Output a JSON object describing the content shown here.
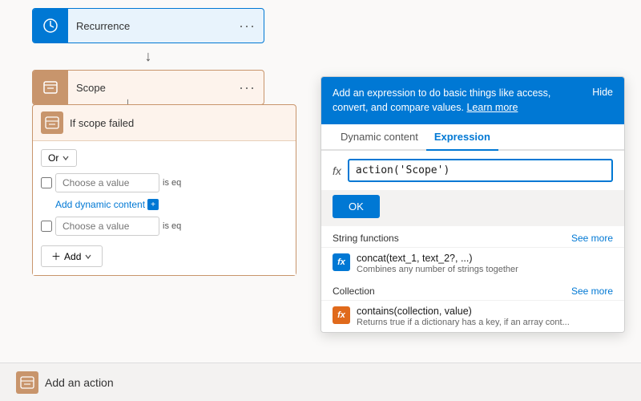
{
  "flow": {
    "recurrence": {
      "label": "Recurrence",
      "more_icon": "..."
    },
    "scope": {
      "label": "Scope",
      "more_icon": "..."
    },
    "condition": {
      "label": "If scope failed",
      "or_label": "Or",
      "row1_placeholder": "Choose a value",
      "row1_badge": "is eq",
      "dynamic_content_label": "Add dynamic content",
      "row2_placeholder": "Choose a value",
      "row2_badge": "is eq",
      "add_label": "Add"
    }
  },
  "bottom_bar": {
    "add_action_label": "Add an action"
  },
  "expression_panel": {
    "header_text": "Add an expression to do basic things like access, convert, and compare values.",
    "learn_more": "Learn more",
    "hide_label": "Hide",
    "tabs": [
      {
        "id": "dynamic",
        "label": "Dynamic content"
      },
      {
        "id": "expression",
        "label": "Expression"
      }
    ],
    "active_tab": "expression",
    "fx_label": "fx",
    "expression_value": "action('Scope')",
    "ok_label": "OK",
    "sections": [
      {
        "id": "string-functions",
        "title": "String functions",
        "see_more": "See more",
        "items": [
          {
            "name": "concat(text_1, text_2?, ...)",
            "description": "Combines any number of strings together",
            "icon_type": "blue"
          }
        ]
      },
      {
        "id": "collection",
        "title": "Collection",
        "see_more": "See more",
        "items": [
          {
            "name": "contains(collection, value)",
            "description": "Returns true if a dictionary has a key, if an array cont...",
            "icon_type": "orange"
          }
        ]
      }
    ]
  }
}
